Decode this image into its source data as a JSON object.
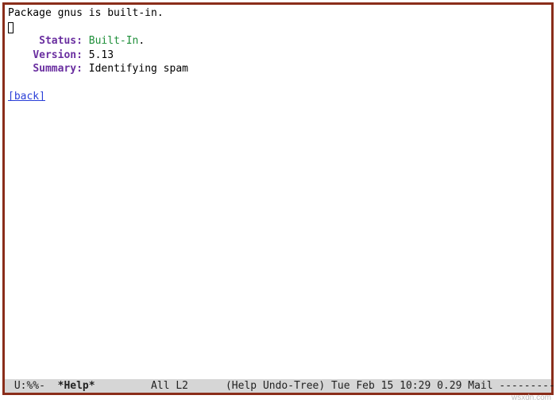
{
  "package": {
    "header": "Package gnus is built-in.",
    "fields": {
      "status_label": "Status:",
      "status_value": "Built-In",
      "status_suffix": ".",
      "version_label": "Version:",
      "version_value": "5.13",
      "summary_label": "Summary:",
      "summary_value": "Identifying spam"
    },
    "back": "[back]"
  },
  "modeline": {
    "left": "U:%%-",
    "buffer": "*Help*",
    "position": "All L2",
    "modes": "(Help Undo-Tree)",
    "datetime": "Tue Feb 15 10:29",
    "load": "0.29",
    "tail": "Mail"
  },
  "watermark": "wsxdn.com"
}
